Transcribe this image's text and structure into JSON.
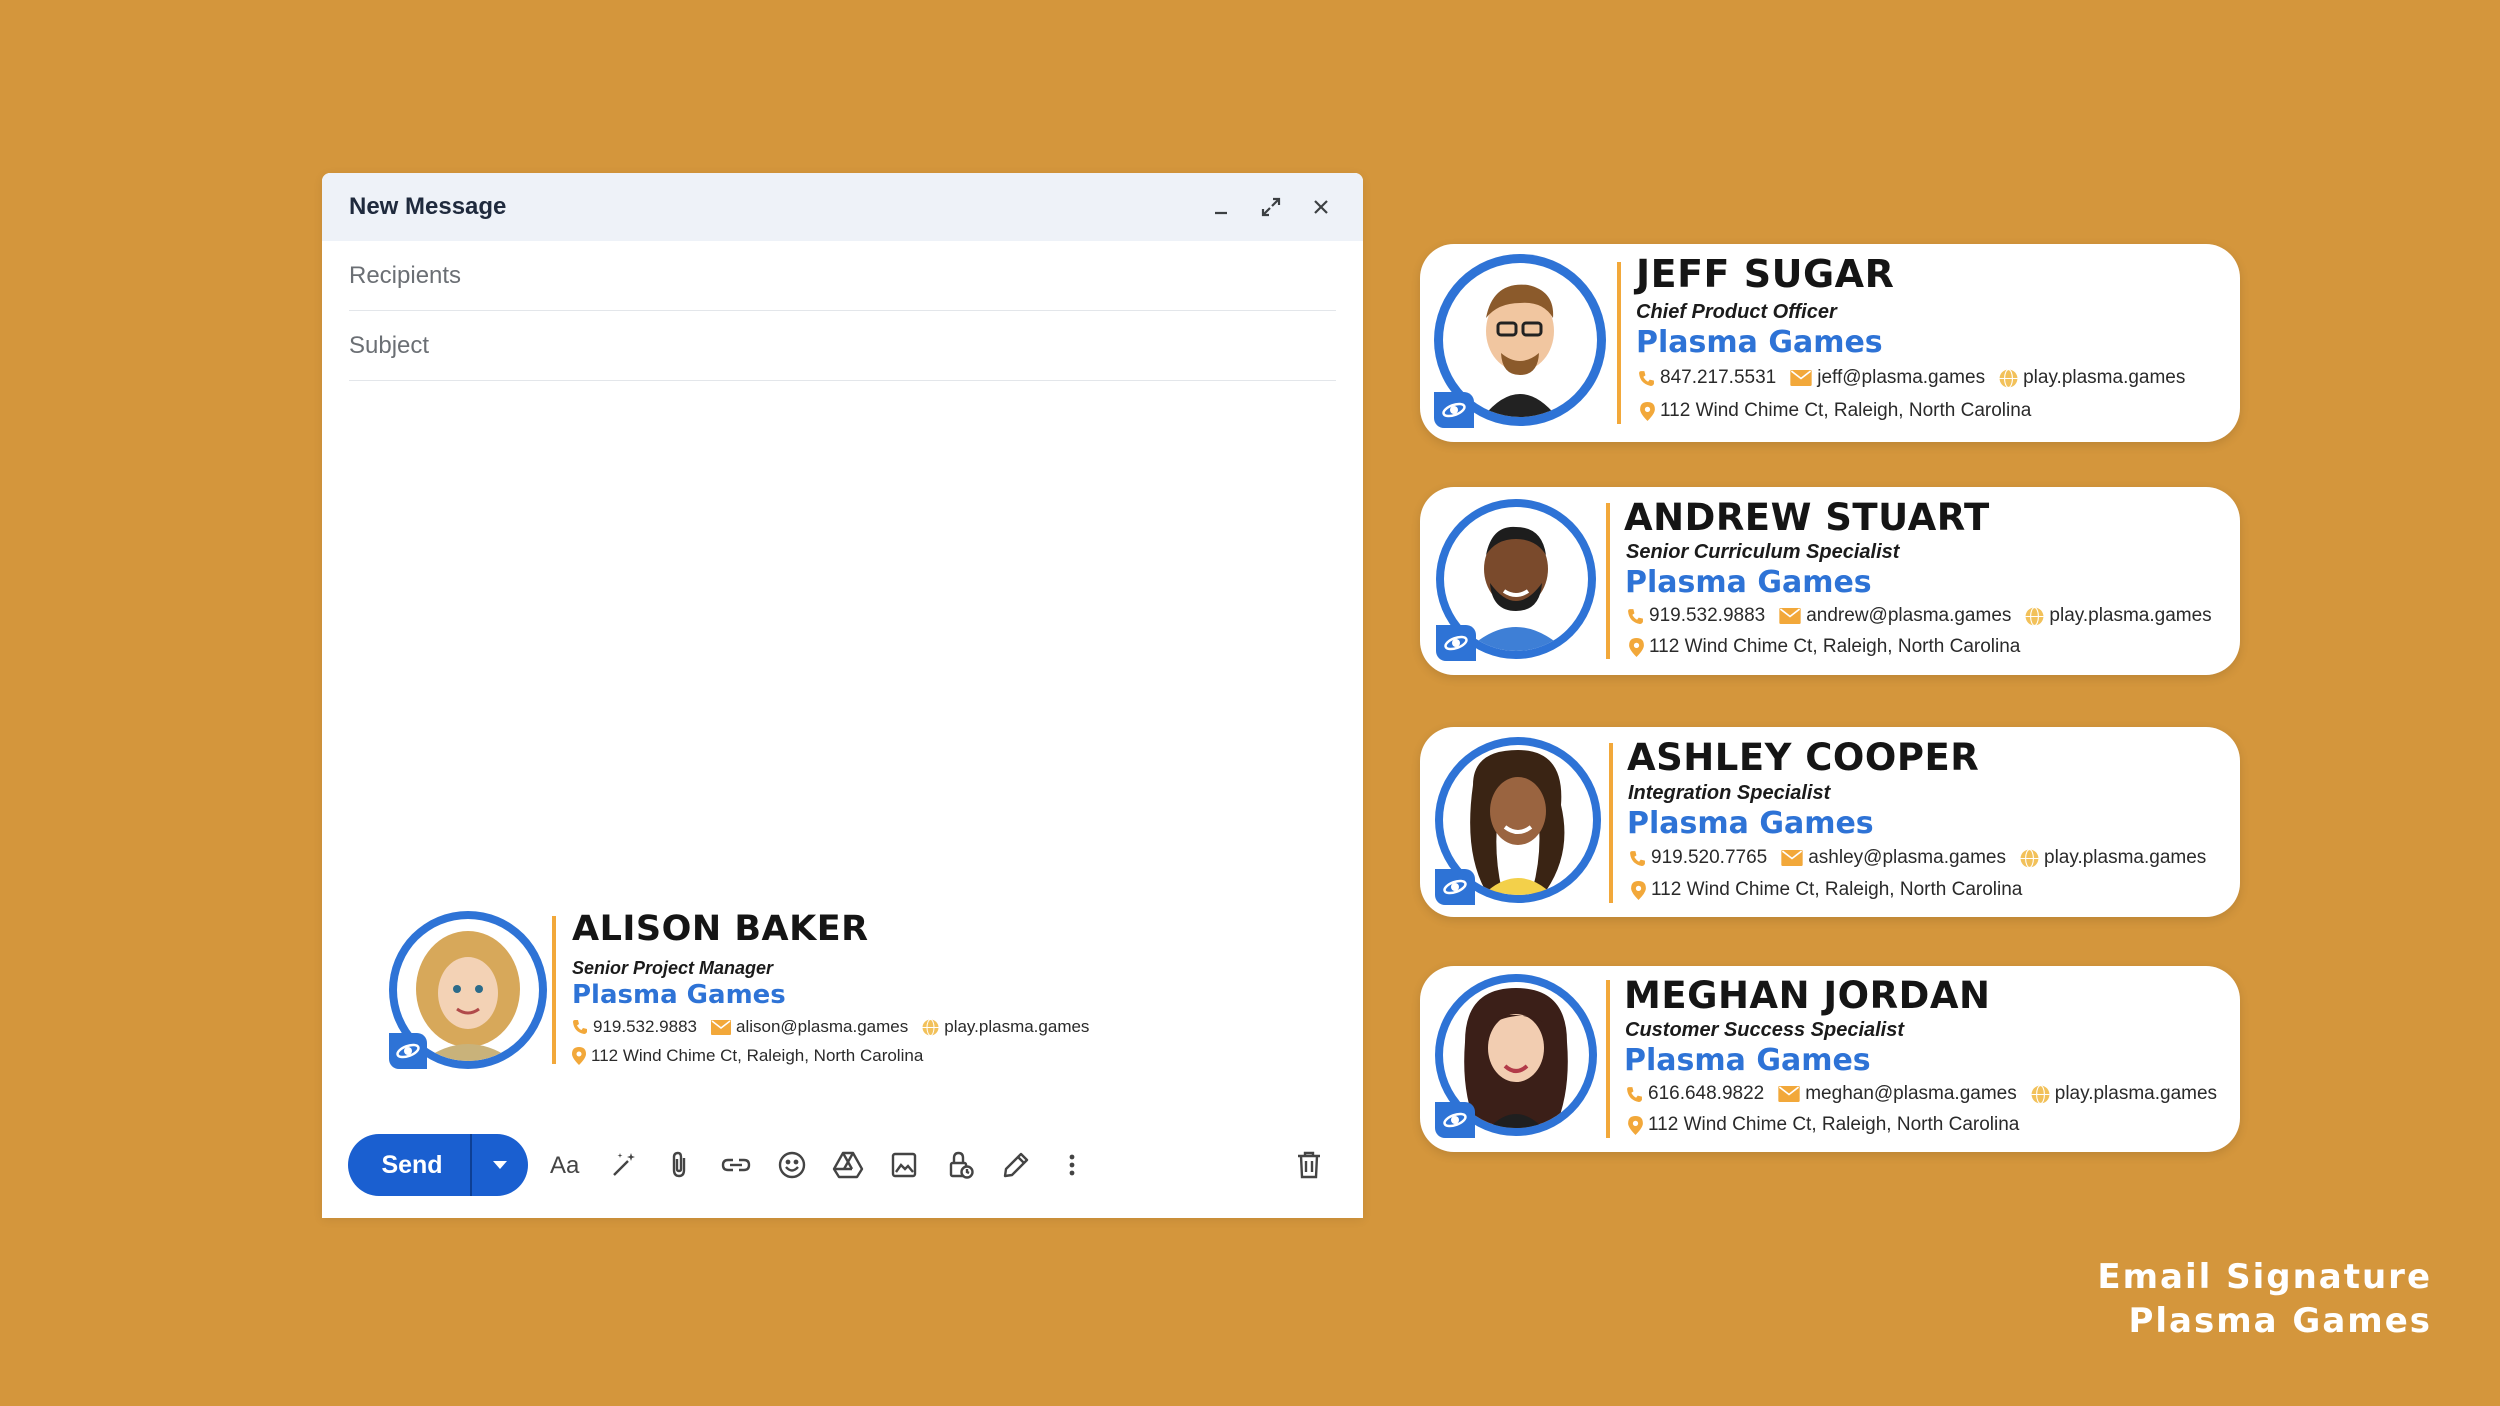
{
  "compose": {
    "title": "New Message",
    "recipients_placeholder": "Recipients",
    "subject_placeholder": "Subject",
    "send_label": "Send"
  },
  "compose_signature": {
    "name": "ALISON BAKER",
    "title": "Senior Project Manager",
    "company": "Plasma Games",
    "phone": "919.532.9883",
    "email": "alison@plasma.games",
    "website": "play.plasma.games",
    "address": "112 Wind Chime Ct, Raleigh, North Carolina"
  },
  "cards": [
    {
      "name": "JEFF SUGAR",
      "title": "Chief Product Officer",
      "company": "Plasma Games",
      "phone": "847.217.5531",
      "email": "jeff@plasma.games",
      "website": "play.plasma.games",
      "address": "112 Wind Chime Ct, Raleigh, North Carolina"
    },
    {
      "name": "ANDREW STUART",
      "title": "Senior Curriculum Specialist",
      "company": "Plasma Games",
      "phone": "919.532.9883",
      "email": "andrew@plasma.games",
      "website": "play.plasma.games",
      "address": "112 Wind Chime Ct, Raleigh, North Carolina"
    },
    {
      "name": "ASHLEY COOPER",
      "title": "Integration Specialist",
      "company": "Plasma Games",
      "phone": "919.520.7765",
      "email": "ashley@plasma.games",
      "website": "play.plasma.games",
      "address": "112 Wind Chime Ct, Raleigh, North Carolina"
    },
    {
      "name": "MEGHAN JORDAN",
      "title": "Customer Success Specialist",
      "company": "Plasma Games",
      "phone": "616.648.9822",
      "email": "meghan@plasma.games",
      "website": "play.plasma.games",
      "address": "112 Wind Chime Ct, Raleigh, North Carolina"
    }
  ],
  "caption": {
    "line1": "Email Signature",
    "line2": "Plasma Games"
  },
  "colors": {
    "background": "#D4963C",
    "brand_blue": "#2E73D6",
    "accent_orange": "#F2A83A",
    "send_blue": "#1A5FD0"
  }
}
